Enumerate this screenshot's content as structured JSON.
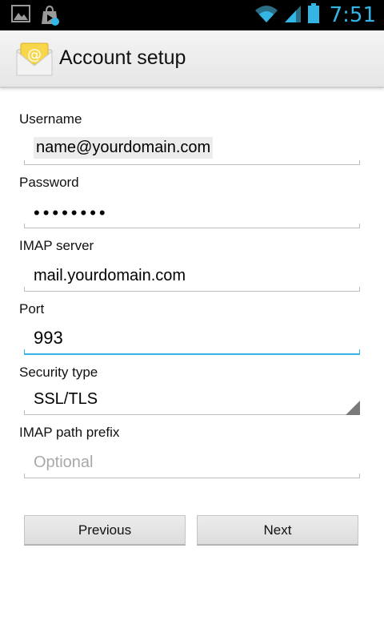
{
  "status_bar": {
    "time": "7:51",
    "icons": [
      "gallery-icon",
      "play-store-icon",
      "wifi-icon",
      "signal-icon",
      "battery-icon"
    ],
    "accent_color": "#33b5e5"
  },
  "action_bar": {
    "title": "Account setup",
    "icon": "email-icon"
  },
  "form": {
    "username": {
      "label": "Username",
      "value": "name@yourdomain.com"
    },
    "password": {
      "label": "Password",
      "value": "••••••••"
    },
    "imap_server": {
      "label": "IMAP server",
      "value": "mail.yourdomain.com"
    },
    "port": {
      "label": "Port",
      "value": "993"
    },
    "security_type": {
      "label": "Security type",
      "value": "SSL/TLS"
    },
    "imap_path_prefix": {
      "label": "IMAP path prefix",
      "placeholder": "Optional"
    }
  },
  "buttons": {
    "previous": "Previous",
    "next": "Next"
  }
}
